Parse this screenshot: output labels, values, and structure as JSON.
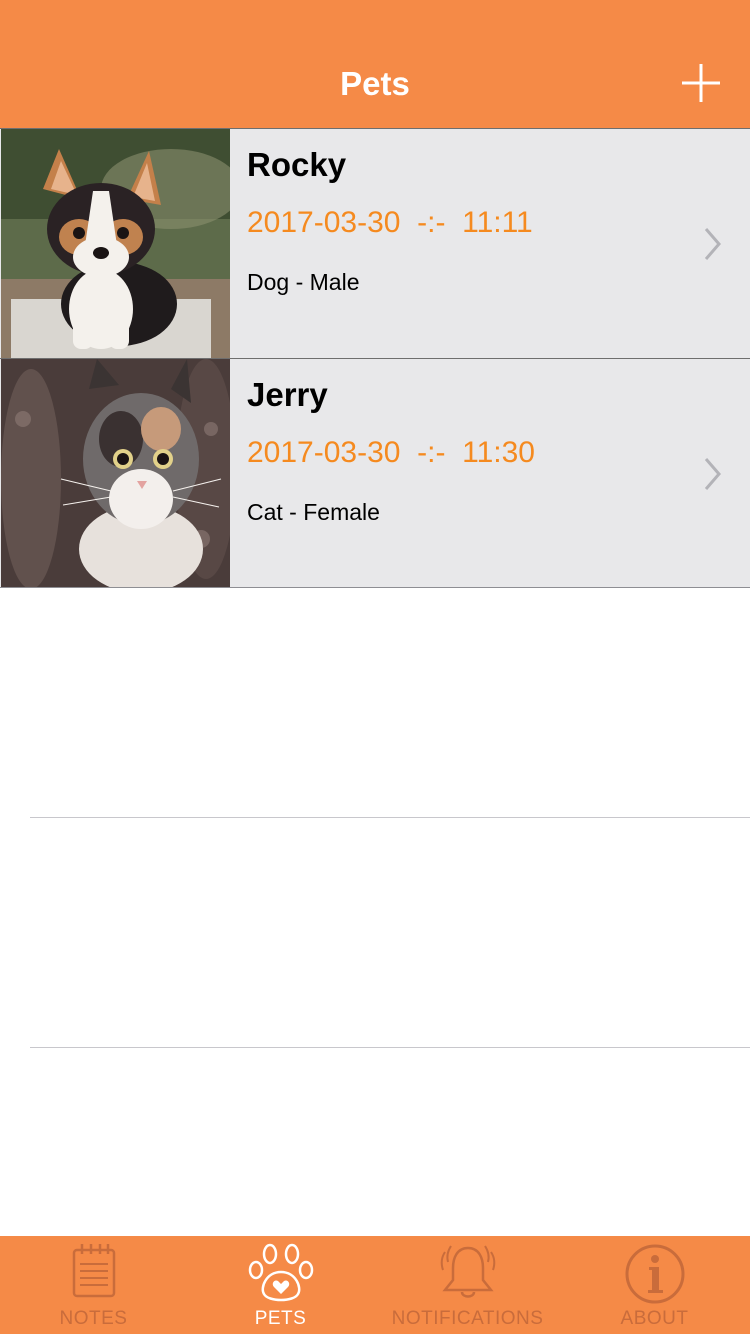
{
  "navbar": {
    "title": "Pets",
    "add_icon": "plus-icon"
  },
  "pets": [
    {
      "name": "Rocky",
      "datetime": "2017-03-30  -:-  11:11",
      "kind": "Dog - Male"
    },
    {
      "name": "Jerry",
      "datetime": "2017-03-30  -:-  11:30",
      "kind": "Cat - Female"
    }
  ],
  "tabbar": {
    "tabs": [
      {
        "label": "NOTES",
        "icon": "notepad-icon",
        "active": false
      },
      {
        "label": "PETS",
        "icon": "paw-icon",
        "active": true
      },
      {
        "label": "NOTIFICATIONS",
        "icon": "bell-icon",
        "active": false
      },
      {
        "label": "ABOUT",
        "icon": "info-icon",
        "active": false
      }
    ]
  },
  "colors": {
    "accent": "#f58a47",
    "date": "#f58a1f",
    "row_bg": "#e8e8ea",
    "tab_inactive": "#c96c3b"
  }
}
